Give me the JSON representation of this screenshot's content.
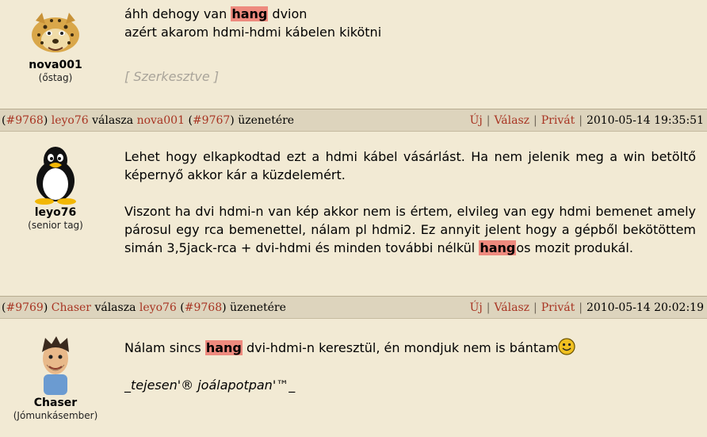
{
  "posts": [
    {
      "author": {
        "name": "nova001",
        "rank": "(őstag)"
      },
      "lines": [
        {
          "before": "áhh dehogy van ",
          "hl": "hang",
          "after": " dvion"
        },
        {
          "text": "azért akarom hdmi-hdmi kábelen kikötni"
        }
      ],
      "edited": "[ Szerkesztve ]"
    },
    {
      "header": {
        "post_id": "#9768",
        "author": "leyo76",
        "reply_word": "válasza",
        "reply_to": "nova001",
        "reply_to_id": "#9767",
        "suffix": "üzenetére",
        "actions": {
          "new": "Új",
          "reply": "Válasz",
          "private": "Privát"
        },
        "date": "2010-05-14 19:35:51"
      },
      "author": {
        "name": "leyo76",
        "rank": "(senior tag)"
      },
      "para1": "Lehet hogy elkapkodtad ezt a hdmi kábel vásárlást. Ha nem jelenik meg a win betöltő képernyő akkor kár a küzdelemért.",
      "para2": {
        "before": "Viszont ha dvi hdmi-n van kép akkor nem is értem, elvileg van egy hdmi bemenet amely párosul egy rca bemenettel, nálam pl hdmi2. Ez annyit jelent hogy a gépből bekötöttem simán 3,5jack-rca + dvi-hdmi és minden további nélkül ",
        "hl": "hang",
        "after": "os mozit produkál."
      }
    },
    {
      "header": {
        "post_id": "#9769",
        "author": "Chaser",
        "reply_word": "válasza",
        "reply_to": "leyo76",
        "reply_to_id": "#9768",
        "suffix": "üzenetére",
        "actions": {
          "new": "Új",
          "reply": "Válasz",
          "private": "Privát"
        },
        "date": "2010-05-14 20:02:19"
      },
      "author": {
        "name": "Chaser",
        "rank": "(Jómunkásember)"
      },
      "line": {
        "before": "Nálam sincs ",
        "hl": "hang",
        "after": " dvi-hdmi-n keresztül, én mondjuk nem is bántam"
      },
      "signature": "_tejesen'® joálapotpan'™_"
    }
  ]
}
